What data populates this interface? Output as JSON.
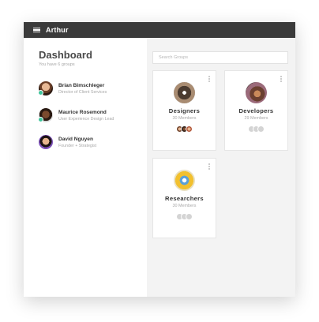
{
  "app": {
    "title": "Arthur"
  },
  "sidebar": {
    "title": "Dashboard",
    "subtitle": "You have 6 groups",
    "people": [
      {
        "name": "Brian Bimschleger",
        "role": "Director of Client Services",
        "online": true
      },
      {
        "name": "Maurice Rosemond",
        "role": "User Experience Design Lead",
        "online": true
      },
      {
        "name": "David Nguyen",
        "role": "Founder + Strategist",
        "online": false
      }
    ]
  },
  "search": {
    "placeholder": "Search Groups"
  },
  "groups": [
    {
      "name": "Designers",
      "members": "30 Members"
    },
    {
      "name": "Developers",
      "members": "29 Members"
    },
    {
      "name": "Researchers",
      "members": "30 Members"
    }
  ],
  "colors": {
    "topbar": "#3a3a3a",
    "online": "#3fc59c",
    "panel": "#f3f3f3"
  },
  "icons": {
    "menu": "hamburger-icon",
    "card_menu": "kebab-menu-icon"
  }
}
